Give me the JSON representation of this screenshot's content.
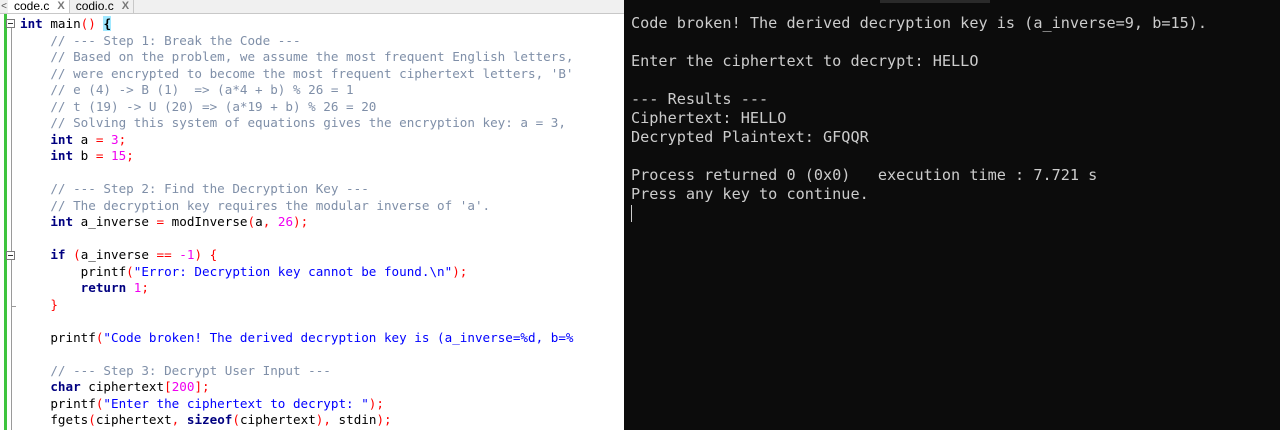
{
  "tabs": [
    {
      "label": "code.c",
      "close": "X"
    },
    {
      "label": "codio.c",
      "close": "X"
    }
  ],
  "tab_edge_glyph": "<",
  "code_lines": [
    [
      {
        "t": "int",
        "c": "kw"
      },
      {
        "t": " main"
      },
      {
        "t": "()",
        "c": "op"
      },
      {
        "t": " "
      },
      {
        "t": "{",
        "c": "brace-hl"
      }
    ],
    [
      {
        "t": "    "
      },
      {
        "t": "// --- Step 1: Break the Code ---",
        "c": "cm"
      }
    ],
    [
      {
        "t": "    "
      },
      {
        "t": "// Based on the problem, we assume the most frequent English letters,",
        "c": "cm"
      }
    ],
    [
      {
        "t": "    "
      },
      {
        "t": "// were encrypted to become the most frequent ciphertext letters, 'B'",
        "c": "cm"
      }
    ],
    [
      {
        "t": "    "
      },
      {
        "t": "// e (4) -> B (1)  => (a*4 + b) % 26 = 1",
        "c": "cm"
      }
    ],
    [
      {
        "t": "    "
      },
      {
        "t": "// t (19) -> U (20) => (a*19 + b) % 26 = 20",
        "c": "cm"
      }
    ],
    [
      {
        "t": "    "
      },
      {
        "t": "// Solving this system of equations gives the encryption key: a = 3,",
        "c": "cm"
      }
    ],
    [
      {
        "t": "    "
      },
      {
        "t": "int",
        "c": "kw"
      },
      {
        "t": " a "
      },
      {
        "t": "=",
        "c": "op"
      },
      {
        "t": " "
      },
      {
        "t": "3",
        "c": "nm"
      },
      {
        "t": ";",
        "c": "op"
      }
    ],
    [
      {
        "t": "    "
      },
      {
        "t": "int",
        "c": "kw"
      },
      {
        "t": " b "
      },
      {
        "t": "=",
        "c": "op"
      },
      {
        "t": " "
      },
      {
        "t": "15",
        "c": "nm"
      },
      {
        "t": ";",
        "c": "op"
      }
    ],
    [],
    [
      {
        "t": "    "
      },
      {
        "t": "// --- Step 2: Find the Decryption Key ---",
        "c": "cm"
      }
    ],
    [
      {
        "t": "    "
      },
      {
        "t": "// The decryption key requires the modular inverse of 'a'.",
        "c": "cm"
      }
    ],
    [
      {
        "t": "    "
      },
      {
        "t": "int",
        "c": "kw"
      },
      {
        "t": " a_inverse "
      },
      {
        "t": "=",
        "c": "op"
      },
      {
        "t": " modInverse"
      },
      {
        "t": "(",
        "c": "op"
      },
      {
        "t": "a"
      },
      {
        "t": ",",
        "c": "op"
      },
      {
        "t": " "
      },
      {
        "t": "26",
        "c": "nm"
      },
      {
        "t": ");",
        "c": "op"
      }
    ],
    [],
    [
      {
        "t": "    "
      },
      {
        "t": "if",
        "c": "kw"
      },
      {
        "t": " "
      },
      {
        "t": "(",
        "c": "op"
      },
      {
        "t": "a_inverse "
      },
      {
        "t": "==",
        "c": "op"
      },
      {
        "t": " "
      },
      {
        "t": "-1",
        "c": "nm"
      },
      {
        "t": ")",
        "c": "op"
      },
      {
        "t": " "
      },
      {
        "t": "{",
        "c": "op"
      }
    ],
    [
      {
        "t": "        printf"
      },
      {
        "t": "(",
        "c": "op"
      },
      {
        "t": "\"Error: Decryption key cannot be found.\\n\"",
        "c": "st"
      },
      {
        "t": ");",
        "c": "op"
      }
    ],
    [
      {
        "t": "        "
      },
      {
        "t": "return",
        "c": "kw"
      },
      {
        "t": " "
      },
      {
        "t": "1",
        "c": "nm"
      },
      {
        "t": ";",
        "c": "op"
      }
    ],
    [
      {
        "t": "    "
      },
      {
        "t": "}",
        "c": "op"
      }
    ],
    [],
    [
      {
        "t": "    printf"
      },
      {
        "t": "(",
        "c": "op"
      },
      {
        "t": "\"Code broken! The derived decryption key is (a_inverse=%d, b=%",
        "c": "st"
      }
    ],
    [],
    [
      {
        "t": "    "
      },
      {
        "t": "// --- Step 3: Decrypt User Input ---",
        "c": "cm"
      }
    ],
    [
      {
        "t": "    "
      },
      {
        "t": "char",
        "c": "kw"
      },
      {
        "t": " ciphertext"
      },
      {
        "t": "[",
        "c": "op"
      },
      {
        "t": "200",
        "c": "nm"
      },
      {
        "t": "];",
        "c": "op"
      }
    ],
    [
      {
        "t": "    printf"
      },
      {
        "t": "(",
        "c": "op"
      },
      {
        "t": "\"Enter the ciphertext to decrypt: \"",
        "c": "st"
      },
      {
        "t": ");",
        "c": "op"
      }
    ],
    [
      {
        "t": "    fgets"
      },
      {
        "t": "(",
        "c": "op"
      },
      {
        "t": "ciphertext"
      },
      {
        "t": ",",
        "c": "op"
      },
      {
        "t": " "
      },
      {
        "t": "sizeof",
        "c": "kw"
      },
      {
        "t": "(",
        "c": "op"
      },
      {
        "t": "ciphertext"
      },
      {
        "t": "),",
        "c": "op"
      },
      {
        "t": " stdin"
      },
      {
        "t": ");",
        "c": "op"
      }
    ]
  ],
  "console_lines": [
    "Code broken! The derived decryption key is (a_inverse=9, b=15).",
    "",
    "Enter the ciphertext to decrypt: HELLO",
    "",
    "--- Results ---",
    "Ciphertext: HELLO",
    "Decrypted Plaintext: GFQQR",
    "",
    "Process returned 0 (0x0)   execution time : 7.721 s",
    "Press any key to continue."
  ]
}
